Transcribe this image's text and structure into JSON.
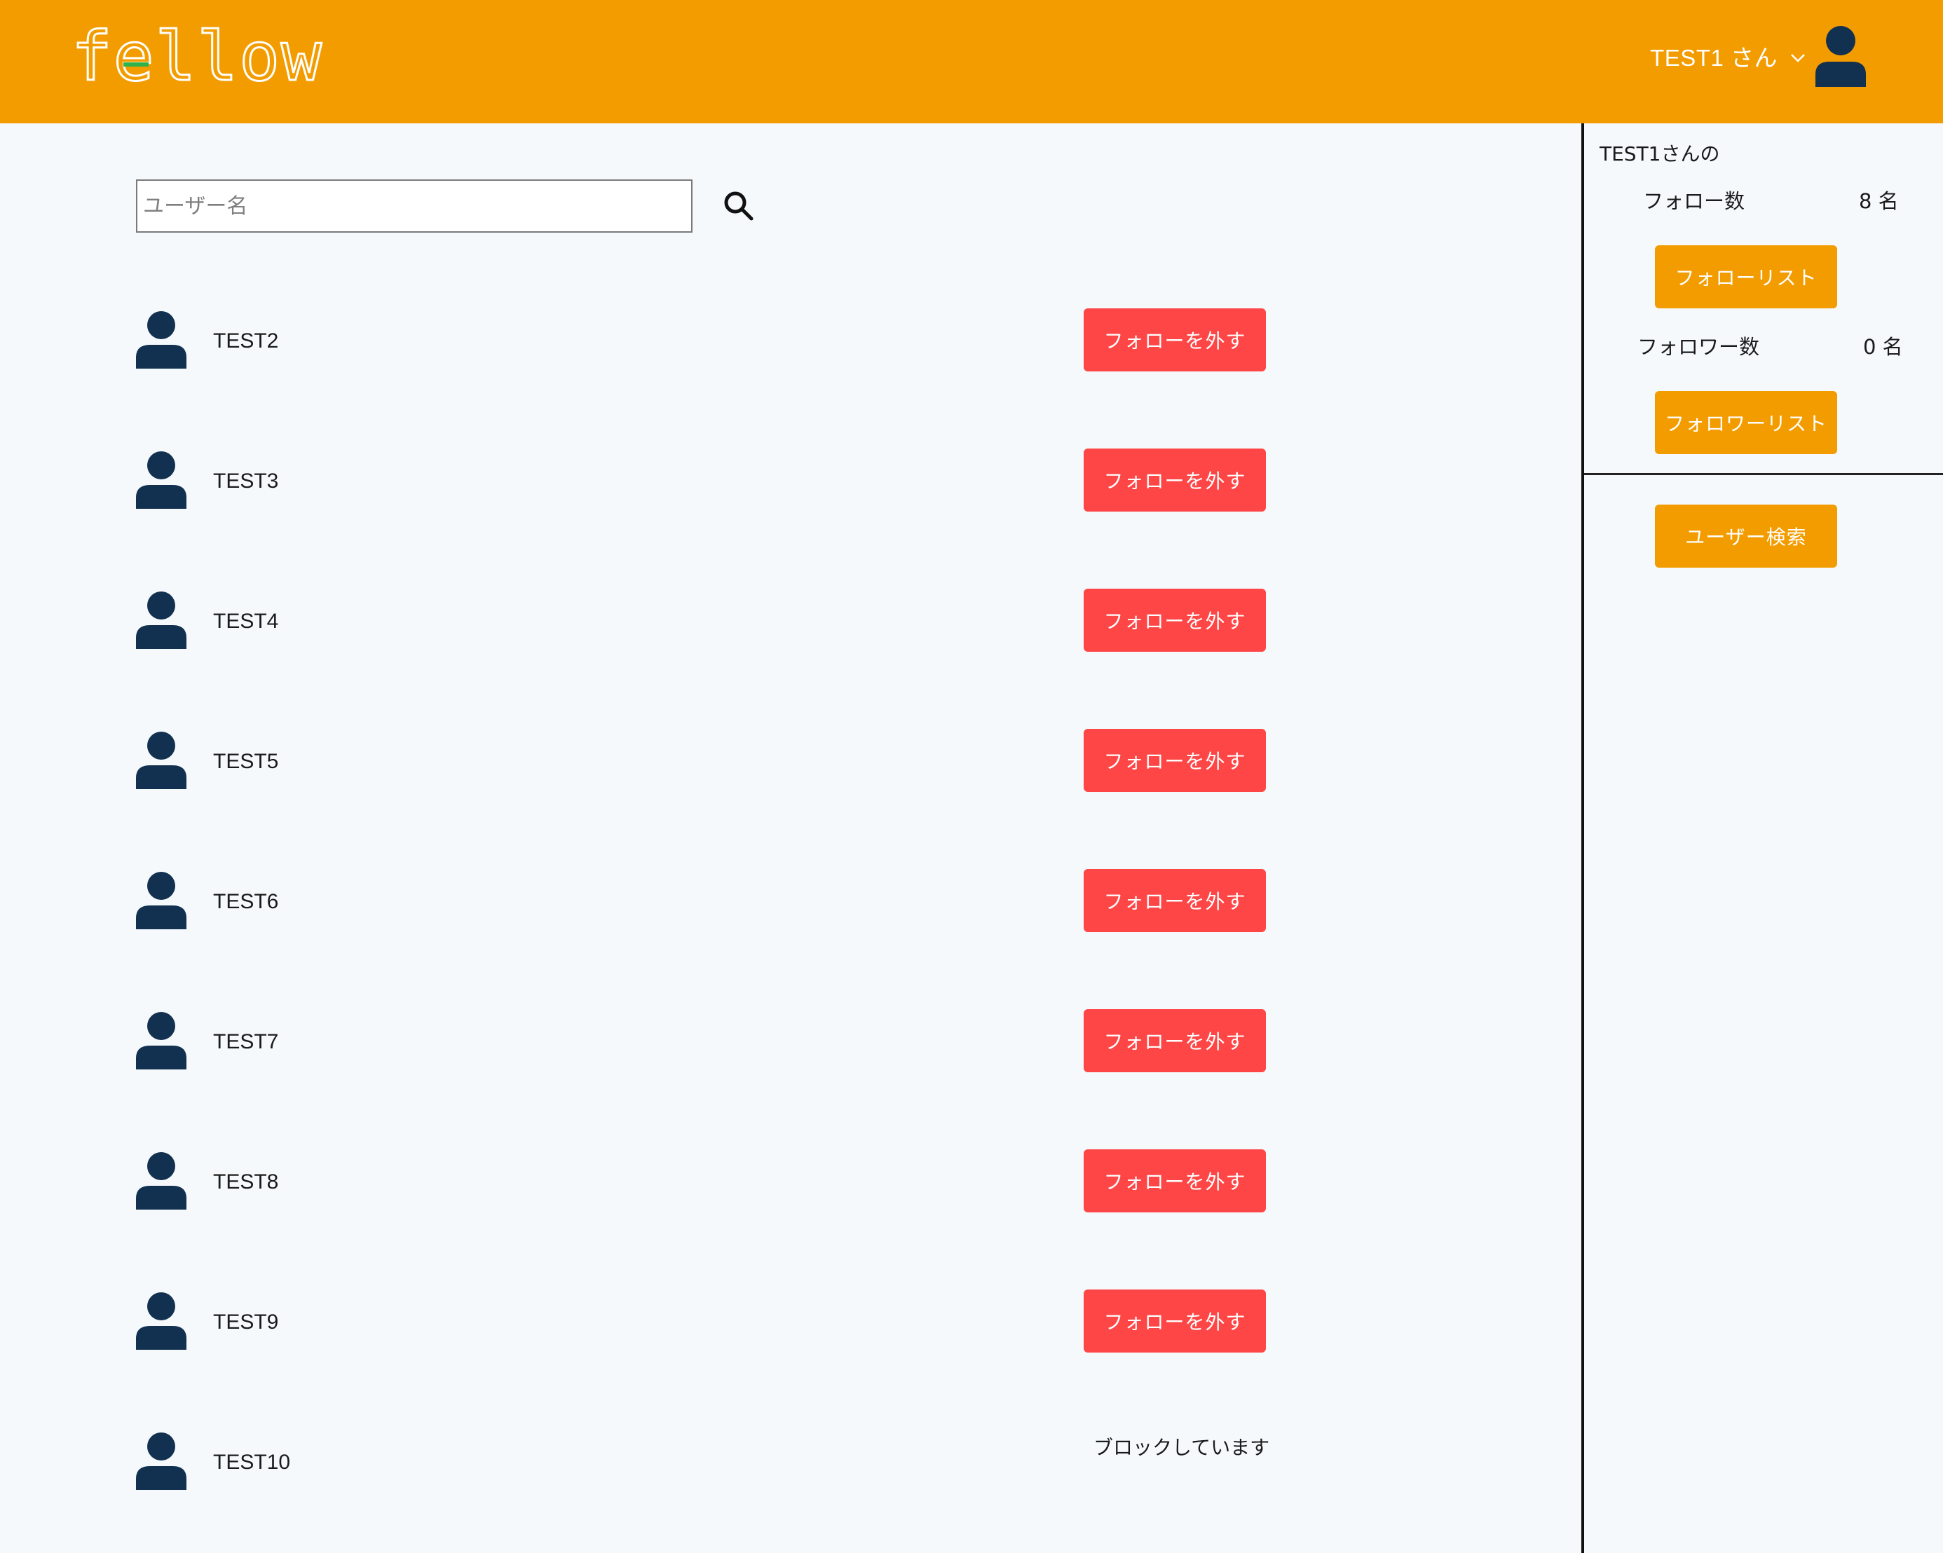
{
  "header": {
    "logo_text": "fellow",
    "user_menu_label": "TEST1 さん",
    "brand_color": "#f39c00"
  },
  "search": {
    "placeholder": "ユーザー名",
    "value": ""
  },
  "users": [
    {
      "name": "TEST2",
      "action": "フォローを外す",
      "status": "following"
    },
    {
      "name": "TEST3",
      "action": "フォローを外す",
      "status": "following"
    },
    {
      "name": "TEST4",
      "action": "フォローを外す",
      "status": "following"
    },
    {
      "name": "TEST5",
      "action": "フォローを外す",
      "status": "following"
    },
    {
      "name": "TEST6",
      "action": "フォローを外す",
      "status": "following"
    },
    {
      "name": "TEST7",
      "action": "フォローを外す",
      "status": "following"
    },
    {
      "name": "TEST8",
      "action": "フォローを外す",
      "status": "following"
    },
    {
      "name": "TEST9",
      "action": "フォローを外す",
      "status": "following"
    },
    {
      "name": "TEST10",
      "action": "ブロックしています",
      "status": "blocked"
    }
  ],
  "sidebar": {
    "title": "TEST1さんの",
    "follow_label": "フォロー数",
    "follow_count": "8 名",
    "follow_list_button": "フォローリスト",
    "follower_label": "フォロワー数",
    "follower_count": "0 名",
    "follower_list_button": "フォロワーリスト",
    "user_search_button": "ユーザー検索"
  },
  "colors": {
    "unfollow_button": "#ff4646",
    "avatar": "#12304f",
    "background": "#f5f9fc"
  }
}
